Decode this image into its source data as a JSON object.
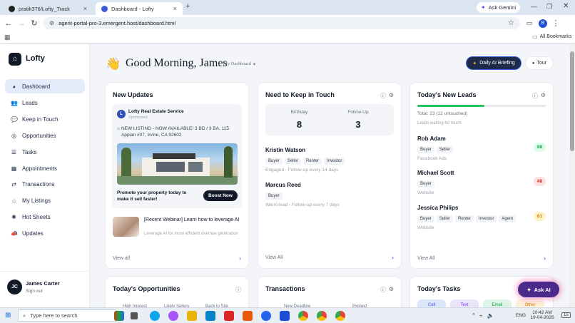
{
  "browser": {
    "tabs": [
      {
        "title": "pratik376/Lofty_Track",
        "active": false
      },
      {
        "title": "Dashboard - Lofty",
        "active": true
      }
    ],
    "ask_gemini": "Ask Gemini",
    "url": "agent-portal-pro-3.emergent.host/dashboard.html",
    "profile_initial": "B",
    "all_bookmarks": "All Bookmarks"
  },
  "sidebar": {
    "brand": "Lofty",
    "items": [
      {
        "label": "Dashboard",
        "icon": "dashboard-icon",
        "active": true
      },
      {
        "label": "Leads",
        "icon": "leads-icon"
      },
      {
        "label": "Keep in Touch",
        "icon": "chat-icon"
      },
      {
        "label": "Opportunities",
        "icon": "target-icon"
      },
      {
        "label": "Tasks",
        "icon": "tasks-icon"
      },
      {
        "label": "Appointments",
        "icon": "calendar-icon"
      },
      {
        "label": "Transactions",
        "icon": "transactions-icon"
      },
      {
        "label": "My Listings",
        "icon": "listings-icon"
      },
      {
        "label": "Hot Sheets",
        "icon": "hot-sheets-icon"
      },
      {
        "label": "Updates",
        "icon": "megaphone-icon"
      }
    ],
    "user": {
      "initials": "JC",
      "name": "James Carter",
      "signout": "Sign out"
    }
  },
  "header": {
    "greeting": "Good Morning, James",
    "dashboard_select": "My Dashboard",
    "ai_briefing": "Daily AI Briefing",
    "tour": "Tour"
  },
  "updates": {
    "title": "New Updates",
    "sponsor_initial": "L",
    "sponsor_name": "Lofty Real Estate Service",
    "sponsored": "Sponsored",
    "listing_text": "NEW LISTING - NOW AVAILABLE! 3 BD / 3 BA, 115 Appian #07, Irvine, CA 92602",
    "promo_text": "Promote your property today to make it sell faster!",
    "boost": "Boost Now",
    "webinar_title": "[Recent Webinar] Learn how to leverage AI",
    "webinar_sub": "Leverage AI for more efficient revenue generation",
    "view_all": "View all"
  },
  "keep_in_touch": {
    "title": "Need to Keep in Touch",
    "birthday_label": "Birthday",
    "birthday_count": "8",
    "followup_label": "Follow-Up",
    "followup_count": "3",
    "contacts": [
      {
        "name": "Kristin Watson",
        "tags": [
          "Buyer",
          "Seller",
          "Renter",
          "Investor"
        ],
        "note": "Engaged - Follow-up every 14 days"
      },
      {
        "name": "Marcus Reed",
        "tags": [
          "Buyer"
        ],
        "note": "Warm lead - Follow-up every 7 days"
      }
    ],
    "view_all": "View All"
  },
  "new_leads": {
    "title": "Today's New Leads",
    "progress": 0.52,
    "total": "Total: 23 (12 untouched)",
    "waiting": "Leads waiting for touch",
    "leads": [
      {
        "name": "Rob Adam",
        "tags": [
          "Buyer",
          "Seller"
        ],
        "source": "Facebook Ads",
        "score": "88",
        "score_color": "#16a34a",
        "score_bg": "#dcfce7"
      },
      {
        "name": "Michael Scott",
        "tags": [
          "Buyer"
        ],
        "source": "Website",
        "score": "48",
        "score_color": "#dc2626",
        "score_bg": "#fee2e2"
      },
      {
        "name": "Jessica Philips",
        "tags": [
          "Buyer",
          "Seller",
          "Renter",
          "Investor",
          "Agent"
        ],
        "source": "Website",
        "score": "61",
        "score_color": "#d97706",
        "score_bg": "#fef3c7"
      }
    ],
    "view_all": "View All"
  },
  "opportunities": {
    "title": "Today's Opportunities",
    "cols": [
      "High Interest",
      "Likely Sellers",
      "Back to Site"
    ]
  },
  "transactions": {
    "title": "Transactions",
    "cols": [
      "New Deadline",
      "Expired"
    ]
  },
  "tasks": {
    "title": "Today's Tasks",
    "cols": [
      "Call",
      "Text",
      "Email",
      "Other"
    ]
  },
  "ask_ai": "Ask AI",
  "taskbar": {
    "search": "Type here to search",
    "lang": "ENG",
    "time": "10:42 AM",
    "date": "19-04-2026",
    "notif": "15"
  },
  "colors": {
    "accent": "#3b5bdb",
    "progress": "#22c55e",
    "ai_dark": "#1e2a4a",
    "ask_ai": "#4c2a8a"
  }
}
